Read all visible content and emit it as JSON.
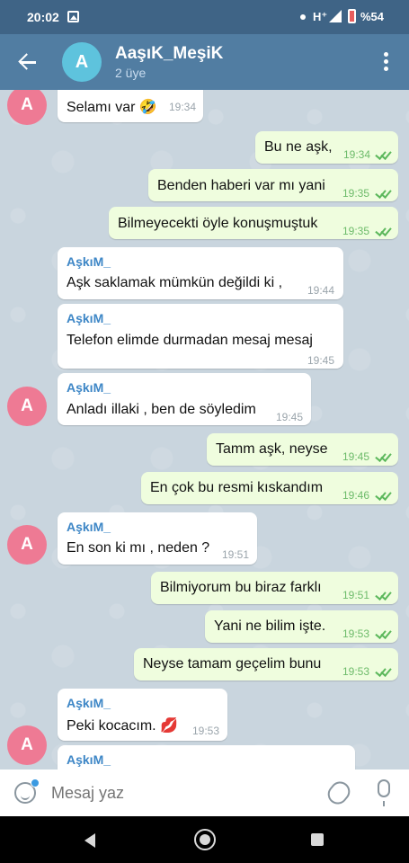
{
  "status_bar": {
    "time": "20:02",
    "network": "H⁺",
    "battery": "%54"
  },
  "header": {
    "avatar_letter": "A",
    "title": "AaşıK_MeşiK",
    "subtitle": "2 üye"
  },
  "messages": [
    {
      "sender": "AşkıM_",
      "text": "Selamı var 🤣",
      "time": "19:34"
    },
    {
      "text": "Bu ne aşk,",
      "time": "19:34"
    },
    {
      "text": "Benden haberi var mı yani",
      "time": "19:35"
    },
    {
      "text": "Bilmeyecekti öyle konuşmuştuk",
      "time": "19:35"
    },
    {
      "sender": "AşkıM_",
      "text": "Aşk saklamak mümkün değildi ki ,",
      "time": "19:44"
    },
    {
      "sender": "AşkıM_",
      "text": "Telefon elimde durmadan mesaj mesaj",
      "time": "19:45"
    },
    {
      "sender": "AşkıM_",
      "text": "Anladı illaki , ben de söyledim",
      "time": "19:45"
    },
    {
      "text": "Tamm aşk, neyse",
      "time": "19:45"
    },
    {
      "text": "En çok bu resmi kıskandım",
      "time": "19:46"
    },
    {
      "sender": "AşkıM_",
      "text": "En son ki mı , neden ?",
      "time": "19:51"
    },
    {
      "text": "Bilmiyorum bu biraz farklı",
      "time": "19:51"
    },
    {
      "text": "Yani ne bilim işte.",
      "time": "19:53"
    },
    {
      "text": "Neyse tamam geçelim bunu",
      "time": "19:53"
    },
    {
      "sender": "AşkıM_",
      "text": "Peki kocacım. 💋",
      "time": "19:53"
    },
    {
      "sender": "AşkıM_"
    }
  ],
  "avatars": {
    "letter": "A"
  },
  "input": {
    "placeholder": "Mesaj yaz"
  },
  "colors": {
    "header": "#517da2",
    "outgoing_bubble": "#effdde",
    "incoming_bubble": "#ffffff",
    "avatar": "#ee7a94",
    "sender_name": "#3d86c6"
  }
}
